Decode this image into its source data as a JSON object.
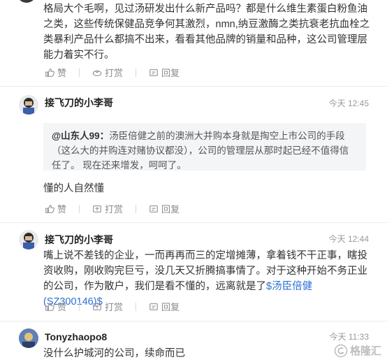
{
  "top_comment": {
    "text": "格局大个毛啊，见过汤研发出什么新产品吗？都是什么维生素蛋白粉鱼油之类，这些传统保健品竞争何其激烈，nmn,纳豆激酶之类抗衰老抗血栓之类暴利产品什么都搞不出来，看看其他品牌的销量和品种，这公司管理层能力着实不行。",
    "actions": {
      "like": "赞",
      "reward": "打赏",
      "reply": "回复"
    }
  },
  "comments": [
    {
      "username": "接飞刀的小李哥",
      "time": "今天 12:45",
      "quote_user": "@山东人99：",
      "quote_text": "汤臣倍健之前的澳洲大并购本身就是掏空上市公司的手段（这么大的并购连对赌协议都没），公司的管理层从那时起已经不值得信任了。 现在还来增发，呵呵了。",
      "text": "懂的人自然懂",
      "actions": {
        "like": "赞",
        "reward": "打赏",
        "reply": "回复"
      }
    },
    {
      "username": "接飞刀的小李哥",
      "time": "今天 12:44",
      "text": "嘴上说不差钱的企业，一而再再而三的定增摊薄，拿着钱不干正事，瞎投资收购，刚收购完巨亏，没几天又折腾搞事情了。对于这种开始不务正业的公司，作为散户，我们是看不懂的，远离就是了",
      "stock_link": "$汤臣倍健(SZ300146)$",
      "actions": {
        "like": "赞",
        "reward": "打赏",
        "reply": "回复"
      }
    },
    {
      "username": "Tonyzhaopo8",
      "time": "今天 11:33",
      "text": "没什么护城河的公司，续命而已"
    }
  ],
  "watermark": {
    "text": "格隆汇"
  }
}
